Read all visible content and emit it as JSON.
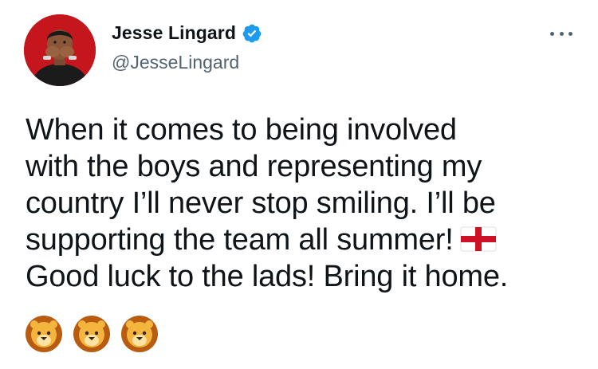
{
  "author": {
    "display_name": "Jesse Lingard",
    "handle": "@JesseLingard",
    "verified": true,
    "avatar_icon": "profile-photo"
  },
  "menu": {
    "icon": "more-horizontal-icon"
  },
  "tweet": {
    "lines": [
      "When it comes to being involved",
      "with the boys and representing my",
      "country I’ll never stop smiling. I’ll be",
      "supporting the team all summer!",
      "Good luck to the lads! Bring it home."
    ],
    "inline_emoji": "england-flag-icon",
    "emojis": [
      "lion-face-icon",
      "lion-face-icon",
      "lion-face-icon"
    ]
  },
  "colors": {
    "text": "#0f1419",
    "secondary": "#536471",
    "verified_blue": "#1d9bf0",
    "avatar_bg": "#c4161c",
    "flag_red": "#ce1124"
  }
}
